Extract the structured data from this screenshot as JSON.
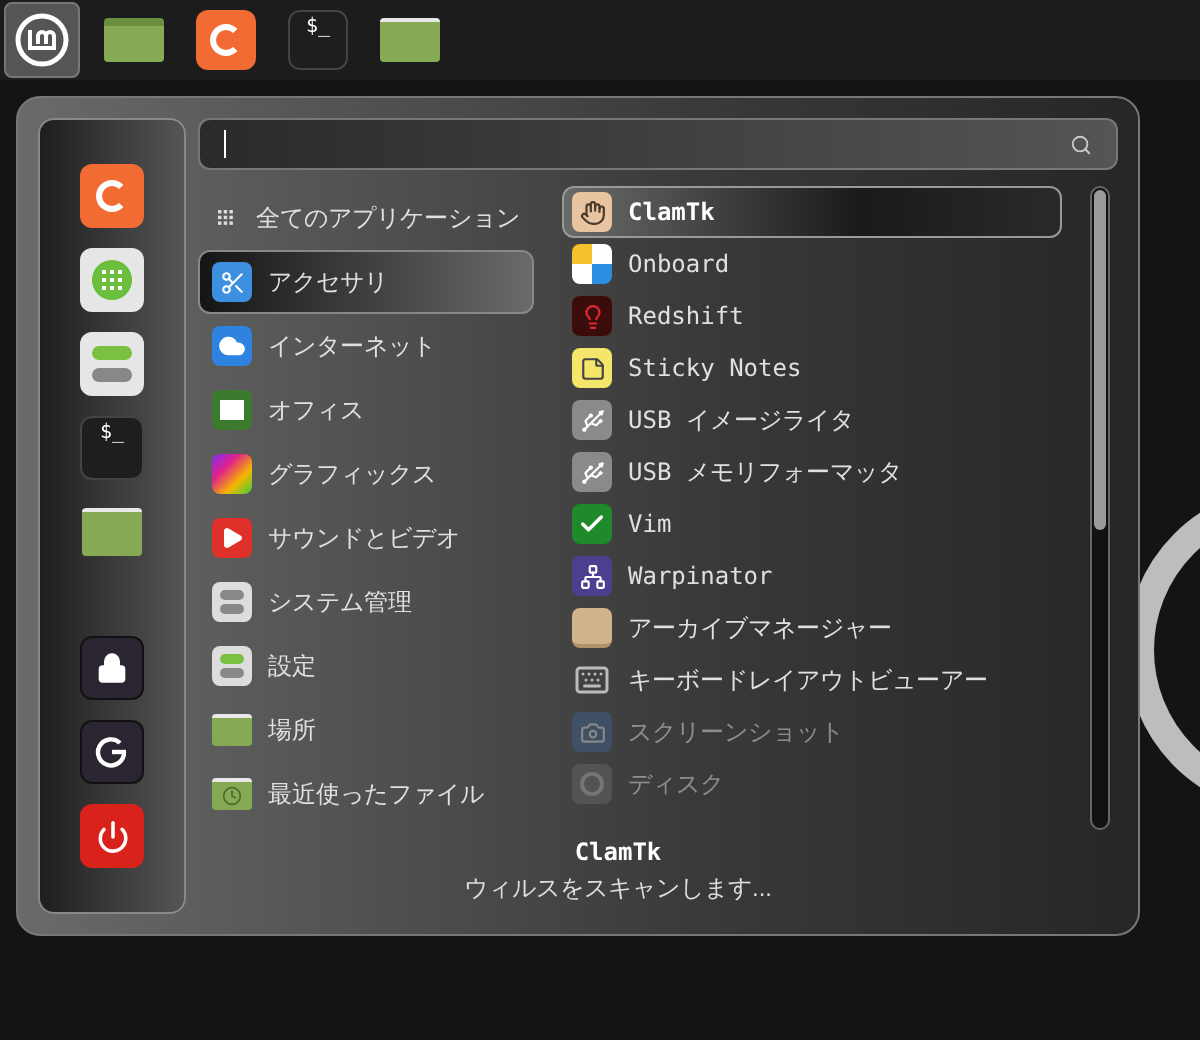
{
  "taskbar": {
    "items": [
      {
        "kind": "menu",
        "selected": true
      },
      {
        "kind": "window",
        "selected": false
      },
      {
        "kind": "browser",
        "selected": false
      },
      {
        "kind": "terminal",
        "selected": false,
        "label": "$_"
      },
      {
        "kind": "folder",
        "selected": false
      }
    ]
  },
  "menu": {
    "favorites": [
      {
        "kind": "browser"
      },
      {
        "kind": "apps"
      },
      {
        "kind": "settings"
      },
      {
        "kind": "terminal",
        "label": "$_"
      },
      {
        "kind": "folder"
      }
    ],
    "session": [
      {
        "kind": "lock"
      },
      {
        "kind": "logout"
      },
      {
        "kind": "power"
      }
    ],
    "search": {
      "focused": true
    },
    "categories": [
      {
        "kind": "all",
        "label": "全てのアプリケーション",
        "selected": false
      },
      {
        "kind": "accessories",
        "label": "アクセサリ",
        "selected": true
      },
      {
        "kind": "internet",
        "label": "インターネット",
        "selected": false
      },
      {
        "kind": "office",
        "label": "オフィス",
        "selected": false
      },
      {
        "kind": "graphics",
        "label": "グラフィックス",
        "selected": false
      },
      {
        "kind": "media",
        "label": "サウンドとビデオ",
        "selected": false
      },
      {
        "kind": "system",
        "label": "システム管理",
        "selected": false
      },
      {
        "kind": "settings",
        "label": "設定",
        "selected": false
      },
      {
        "kind": "places",
        "label": "場所",
        "selected": false
      },
      {
        "kind": "recent",
        "label": "最近使ったファイル",
        "selected": false
      }
    ],
    "apps": [
      {
        "kind": "clamtk",
        "label": "ClamTk",
        "selected": true,
        "faded": false
      },
      {
        "kind": "onboard",
        "label": "Onboard",
        "selected": false,
        "faded": false
      },
      {
        "kind": "redshift",
        "label": "Redshift",
        "selected": false,
        "faded": false
      },
      {
        "kind": "sticky",
        "label": "Sticky Notes",
        "selected": false,
        "faded": false
      },
      {
        "kind": "usb",
        "label": "USB イメージライタ",
        "selected": false,
        "faded": false
      },
      {
        "kind": "usb",
        "label": "USB メモリフォーマッタ",
        "selected": false,
        "faded": false
      },
      {
        "kind": "vim",
        "label": "Vim",
        "selected": false,
        "faded": false
      },
      {
        "kind": "warpinator",
        "label": "Warpinator",
        "selected": false,
        "faded": false
      },
      {
        "kind": "archive",
        "label": "アーカイブマネージャー",
        "selected": false,
        "faded": false
      },
      {
        "kind": "keyboard",
        "label": "キーボードレイアウトビューアー",
        "selected": false,
        "faded": false
      },
      {
        "kind": "screenshot",
        "label": "スクリーンショット",
        "selected": false,
        "faded": true
      },
      {
        "kind": "disk",
        "label": "ディスク",
        "selected": false,
        "faded": true
      }
    ],
    "description": {
      "title": "ClamTk",
      "text": "ウィルスをスキャンします..."
    }
  }
}
